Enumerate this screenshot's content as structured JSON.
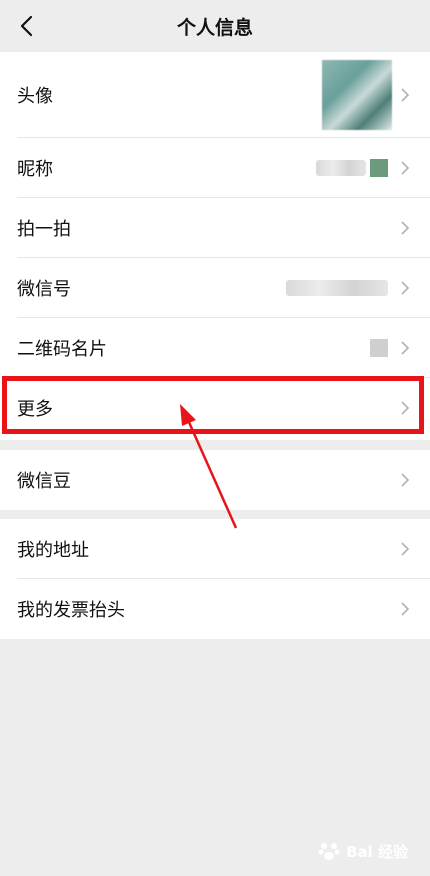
{
  "header": {
    "title": "个人信息",
    "back_icon": "chevron-left-icon"
  },
  "group1": {
    "rows": [
      {
        "label": "头像"
      },
      {
        "label": "昵称"
      },
      {
        "label": "拍一拍"
      },
      {
        "label": "微信号"
      },
      {
        "label": "二维码名片"
      },
      {
        "label": "更多"
      }
    ]
  },
  "group2": {
    "rows": [
      {
        "label": "微信豆"
      }
    ]
  },
  "group3": {
    "rows": [
      {
        "label": "我的地址"
      },
      {
        "label": "我的发票抬头"
      }
    ]
  },
  "watermark": {
    "text": "Bai 经验"
  },
  "colors": {
    "highlight": "#e8141a",
    "background": "#ededed",
    "surface": "#ffffff"
  }
}
